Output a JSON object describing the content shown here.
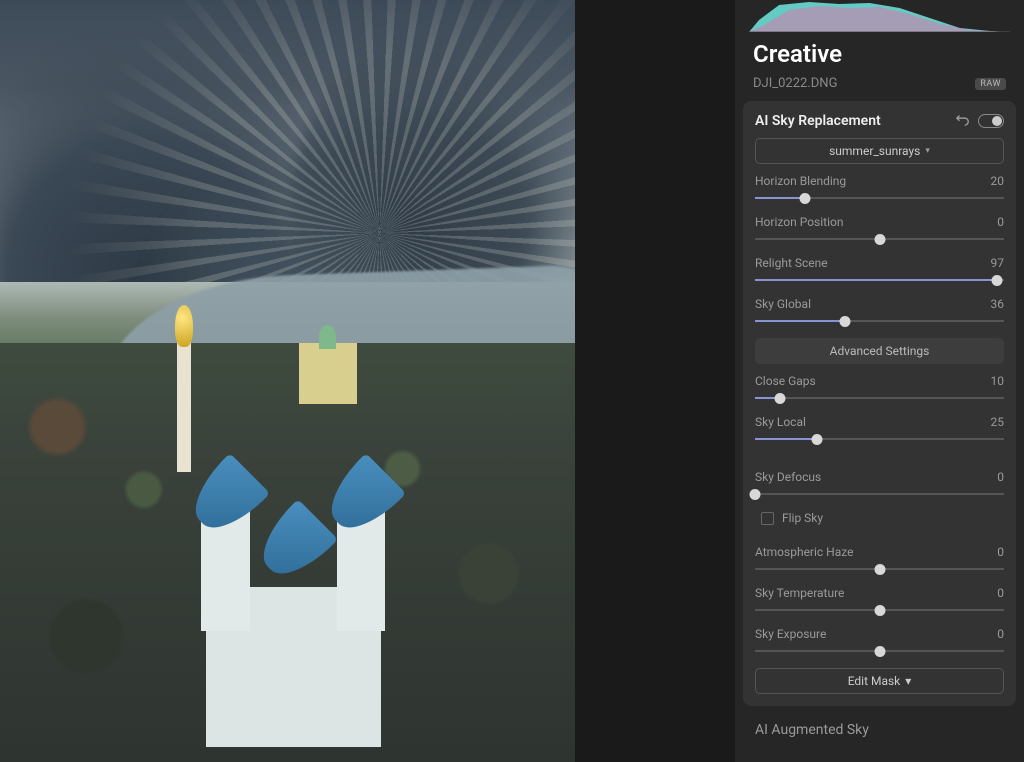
{
  "section_title": "Creative",
  "filename": "DJI_0222.DNG",
  "raw_badge": "RAW",
  "panel": {
    "title": "AI Sky Replacement",
    "preset": "summer_sunrays",
    "advanced_label": "Advanced Settings",
    "edit_mask_label": "Edit Mask",
    "flip_sky_label": "Flip Sky",
    "sliders": {
      "horizon_blending": {
        "label": "Horizon Blending",
        "value": 20,
        "min": 0,
        "max": 100
      },
      "horizon_position": {
        "label": "Horizon Position",
        "value": 0,
        "min": -100,
        "max": 100
      },
      "relight_scene": {
        "label": "Relight Scene",
        "value": 97,
        "min": 0,
        "max": 100
      },
      "sky_global": {
        "label": "Sky Global",
        "value": 36,
        "min": 0,
        "max": 100
      },
      "close_gaps": {
        "label": "Close Gaps",
        "value": 10,
        "min": 0,
        "max": 100
      },
      "sky_local": {
        "label": "Sky Local",
        "value": 25,
        "min": 0,
        "max": 100
      },
      "sky_defocus": {
        "label": "Sky Defocus",
        "value": 0,
        "min": 0,
        "max": 100
      },
      "atmospheric_haze": {
        "label": "Atmospheric Haze",
        "value": 0,
        "min": -100,
        "max": 100
      },
      "sky_temperature": {
        "label": "Sky Temperature",
        "value": 0,
        "min": -100,
        "max": 100
      },
      "sky_exposure": {
        "label": "Sky Exposure",
        "value": 0,
        "min": -100,
        "max": 100
      }
    }
  },
  "next_panel_title": "AI Augmented Sky"
}
